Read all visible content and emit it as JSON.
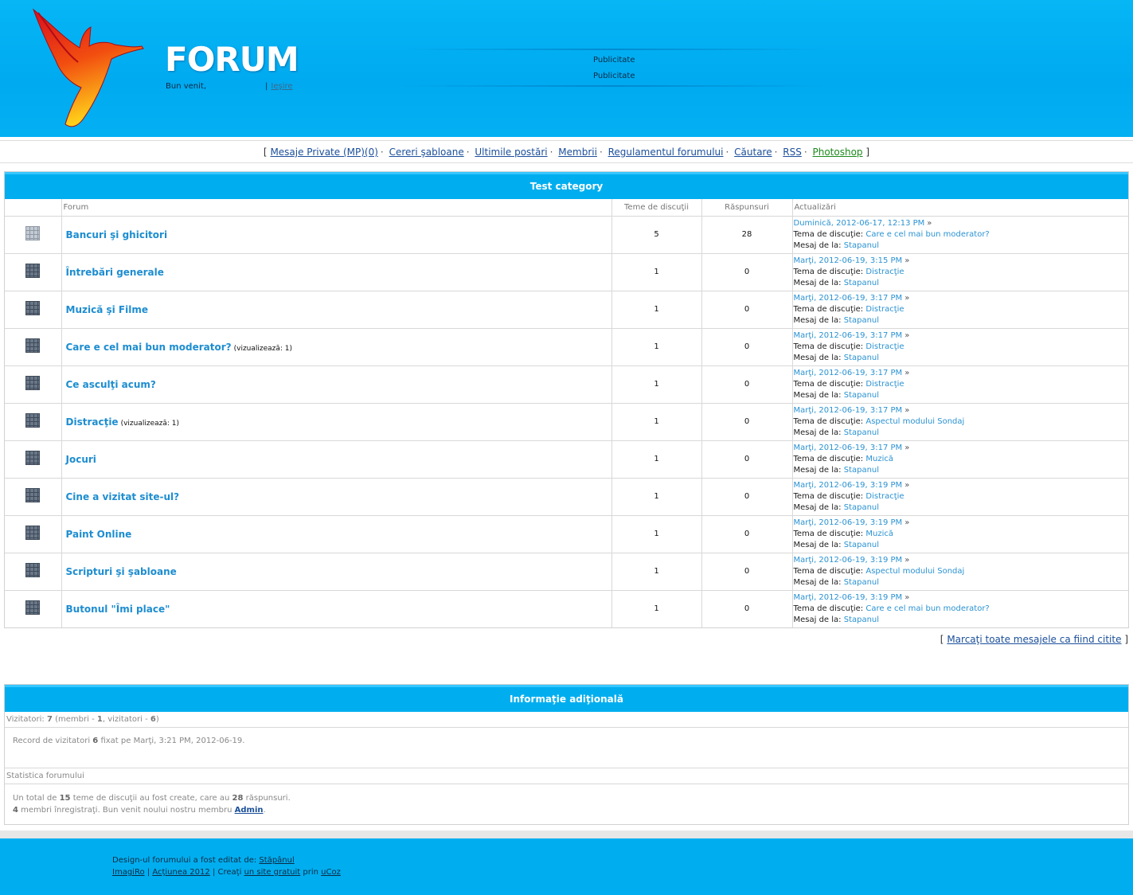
{
  "header": {
    "title": "FORUM",
    "welcome": "Bun venit,",
    "separator": "|",
    "logout": "Ieşire",
    "ad_lines": [
      "Publicitate",
      "Publicitate"
    ],
    "colors": {
      "header_bg": "#00aaf0",
      "accent": "#00aeef"
    }
  },
  "nav": {
    "open": "[",
    "close": "]",
    "items": [
      {
        "label": "Mesaje Private (MP)(0)"
      },
      {
        "label": "Cereri şabloane"
      },
      {
        "label": "Ultimile postări"
      },
      {
        "label": "Membrii"
      },
      {
        "label": "Regulamentul forumului"
      },
      {
        "label": "Căutare"
      },
      {
        "label": "RSS"
      },
      {
        "label": "Photoshop"
      }
    ]
  },
  "category": {
    "title": "Test category",
    "columns": [
      "Forum",
      "Teme de discuţii",
      "Răspunsuri",
      "Actualizări"
    ],
    "labels": {
      "topic": "Tema de discuţie:",
      "by": "Mesaj de la:"
    },
    "rows": [
      {
        "name": "Bancuri şi ghicitori",
        "views": "",
        "topics": "5",
        "replies": "28",
        "date": "Duminică, 2012-06-17, 12:13 PM",
        "topic": "Care e cel mai bun moderator?",
        "by": "Stapanul"
      },
      {
        "name": "Întrebări generale",
        "views": "",
        "topics": "1",
        "replies": "0",
        "date": "Marţi, 2012-06-19, 3:15 PM",
        "topic": "Distracţie",
        "by": "Stapanul"
      },
      {
        "name": "Muzică şi Filme",
        "views": "",
        "topics": "1",
        "replies": "0",
        "date": "Marţi, 2012-06-19, 3:17 PM",
        "topic": "Distracţie",
        "by": "Stapanul"
      },
      {
        "name": "Care e cel mai bun moderator?",
        "views": "(vizualizează: 1)",
        "topics": "1",
        "replies": "0",
        "date": "Marţi, 2012-06-19, 3:17 PM",
        "topic": "Distracţie",
        "by": "Stapanul"
      },
      {
        "name": "Ce asculţi acum?",
        "views": "",
        "topics": "1",
        "replies": "0",
        "date": "Marţi, 2012-06-19, 3:17 PM",
        "topic": "Distracţie",
        "by": "Stapanul"
      },
      {
        "name": "Distracţie",
        "views": "(vizualizează: 1)",
        "topics": "1",
        "replies": "0",
        "date": "Marţi, 2012-06-19, 3:17 PM",
        "topic": "Aspectul modului Sondaj",
        "by": "Stapanul"
      },
      {
        "name": "Jocuri",
        "views": "",
        "topics": "1",
        "replies": "0",
        "date": "Marţi, 2012-06-19, 3:17 PM",
        "topic": "Muzică",
        "by": "Stapanul"
      },
      {
        "name": "Cine a vizitat site-ul?",
        "views": "",
        "topics": "1",
        "replies": "0",
        "date": "Marţi, 2012-06-19, 3:19 PM",
        "topic": "Distracţie",
        "by": "Stapanul"
      },
      {
        "name": "Paint Online",
        "views": "",
        "topics": "1",
        "replies": "0",
        "date": "Marţi, 2012-06-19, 3:19 PM",
        "topic": "Muzică",
        "by": "Stapanul"
      },
      {
        "name": "Scripturi şi şabloane",
        "views": "",
        "topics": "1",
        "replies": "0",
        "date": "Marţi, 2012-06-19, 3:19 PM",
        "topic": "Aspectul modului Sondaj",
        "by": "Stapanul"
      },
      {
        "name": "Butonul \"Îmi place\"",
        "views": "",
        "topics": "1",
        "replies": "0",
        "date": "Marţi, 2012-06-19, 3:19 PM",
        "topic": "Care e cel mai bun moderator?",
        "by": "Stapanul"
      }
    ]
  },
  "mark_all": {
    "open": "[",
    "label": "Marcaţi toate mesajele ca fiind citite",
    "close": "]"
  },
  "info": {
    "title": "Informaţie adiţională",
    "visitors": {
      "label": "Vizitatori:",
      "total": "7",
      "members_label": "(membri -",
      "members": "1",
      "guests_label": ", vizitatori -",
      "guests": "6",
      "end": ")"
    },
    "record": {
      "pre": "Record de vizitatori",
      "count": "6",
      "post": "fixat pe Marţi, 3:21 PM, 2012-06-19."
    },
    "stats_label": "Statistica forumului",
    "stats1": {
      "pre": "Un total de",
      "topics": "15",
      "mid": "teme de discuţii au fost create, care au",
      "replies": "28",
      "post": "răspunsuri."
    },
    "stats2": {
      "members": "4",
      "mid": "membri înregistraţi. Bun venit noului nostru membru",
      "newest": "Admin",
      "end": "."
    }
  },
  "footer": {
    "line1_text": "Design-ul forumului a fost editat de:",
    "line1_link": "Stăpânul",
    "line2": [
      {
        "label": "ImagiRo"
      },
      {
        "label": "Acţiunea 2012"
      }
    ],
    "sep": "|",
    "create_pre": "Creaţi",
    "create_link": "un site gratuit",
    "create_mid": "prin",
    "ucoz": "uCoz"
  }
}
